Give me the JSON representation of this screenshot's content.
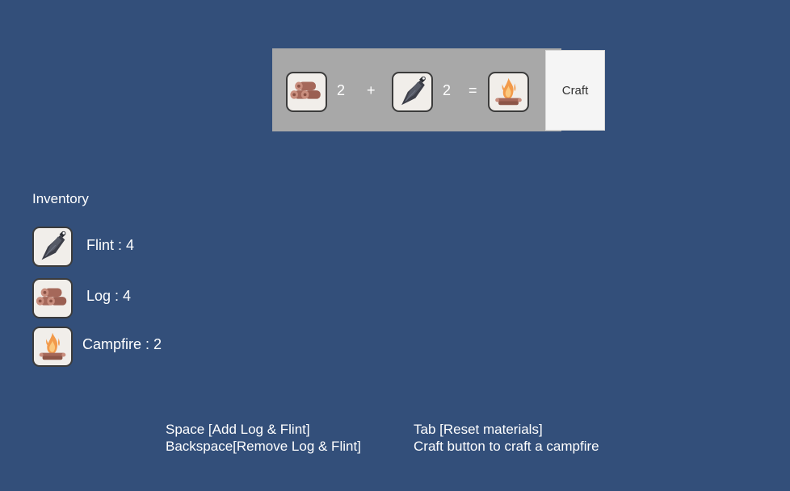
{
  "recipe": {
    "ingredient_1": {
      "item": "log-icon",
      "count": "2"
    },
    "plus_sign": "+",
    "ingredient_2": {
      "item": "flint-icon",
      "count": "2"
    },
    "equals_sign": "=",
    "result": {
      "item": "campfire-icon"
    },
    "craft_label": "Craft"
  },
  "inventory": {
    "title": "Inventory",
    "items": [
      {
        "icon": "flint-icon",
        "label": "Flint : 4"
      },
      {
        "icon": "log-icon",
        "label": "Log : 4"
      },
      {
        "icon": "campfire-icon",
        "label": "Campfire : 2"
      }
    ]
  },
  "help": {
    "left_line_1": "Space [Add Log & Flint]",
    "left_line_2": "Backspace[Remove Log & Flint]",
    "right_line_1": "Tab [Reset materials]",
    "right_line_2": "Craft button to craft a campfire"
  },
  "colors": {
    "background": "#334f7a",
    "recipe_panel": "#a8a8a8",
    "slot_fill": "#f1eeea",
    "slot_border": "#3b3b3b",
    "craft_button": "#f5f5f5"
  }
}
